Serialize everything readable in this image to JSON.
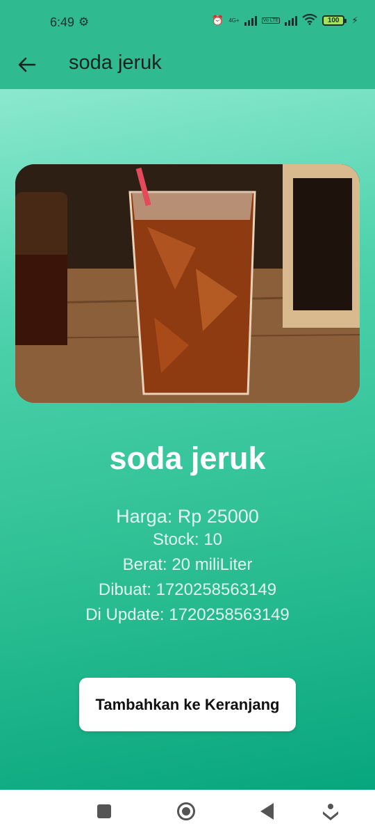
{
  "status_bar": {
    "time": "6:49",
    "network_1": "4G+",
    "volte": "Vo LTE",
    "battery": "100"
  },
  "app_bar": {
    "title": "soda jeruk"
  },
  "product": {
    "name": "soda jeruk",
    "image_label": "glass of soda with ice and straw",
    "price_line": "Harga: Rp 25000",
    "stock_line": "Stock: 10",
    "weight_line": "Berat: 20 miliLiter",
    "created_line": "Dibuat: 1720258563149",
    "updated_line": "Di Update: 1720258563149"
  },
  "actions": {
    "add_to_cart_label": "Tambahkan ke Keranjang"
  },
  "colors": {
    "app_bar": "#2fba8f",
    "gradient_top": "#8be8cf",
    "gradient_bottom": "#08a67e",
    "button_bg": "#ffffff"
  },
  "icons": {
    "back": "arrow-left-icon",
    "settings": "gear-icon",
    "alarm": "alarm-icon",
    "wifi": "wifi-icon",
    "battery": "battery-icon",
    "charging": "lightning-icon"
  }
}
